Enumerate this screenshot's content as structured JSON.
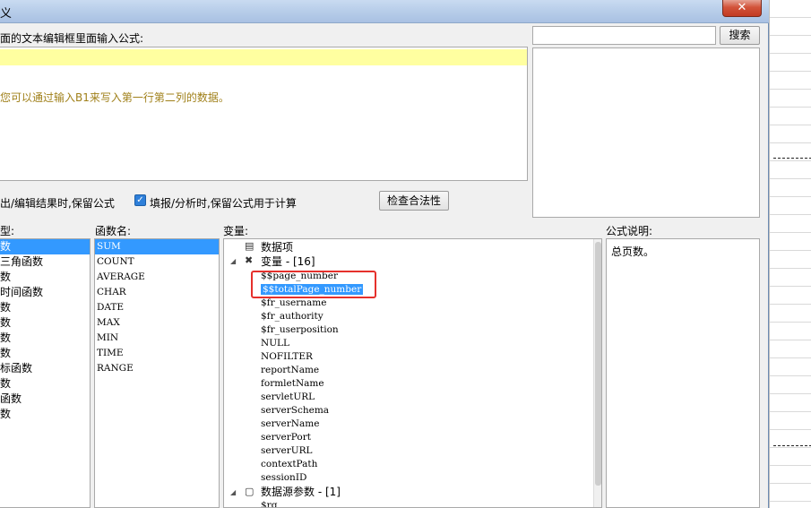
{
  "window": {
    "title": "义",
    "close_label": "✕"
  },
  "editor": {
    "prompt": "面的文本编辑框里面输入公式:",
    "hint": "您可以通过输入B1来写入第一行第二列的数据。"
  },
  "search": {
    "value": "",
    "button": "搜索"
  },
  "options": {
    "opt1": "出/编辑结果时,保留公式",
    "opt2_checked": true,
    "opt2": "填报/分析时,保留公式用于计算",
    "check_button": "检查合法性"
  },
  "labels": {
    "type": "型:",
    "function": "函数名:",
    "variable": "变量:",
    "description": "公式说明:"
  },
  "types": [
    "数",
    "三角函数",
    "数",
    "时间函数",
    "数",
    "数",
    "数",
    "数",
    "标函数",
    "数",
    "函数",
    "数"
  ],
  "functions": [
    "SUM",
    "COUNT",
    "AVERAGE",
    "CHAR",
    "DATE",
    "MAX",
    "MIN",
    "TIME",
    "RANGE"
  ],
  "variables": {
    "data_item": "数据项",
    "var_group": "变量 - [16]",
    "items": [
      "$$page_number",
      "$$totalPage_number",
      "$fr_username",
      "$fr_authority",
      "$fr_userposition",
      "NULL",
      "NOFILTER",
      "reportName",
      "formletName",
      "servletURL",
      "serverSchema",
      "serverName",
      "serverPort",
      "serverURL",
      "contextPath",
      "sessionID"
    ],
    "ds_group": "数据源参数 - [1]",
    "ds_items": [
      "$rq"
    ]
  },
  "description": "总页数。",
  "icons": {
    "collapse": "triangle-down-icon",
    "data": "data-item-icon",
    "var": "variable-icon",
    "param": "param-icon"
  }
}
